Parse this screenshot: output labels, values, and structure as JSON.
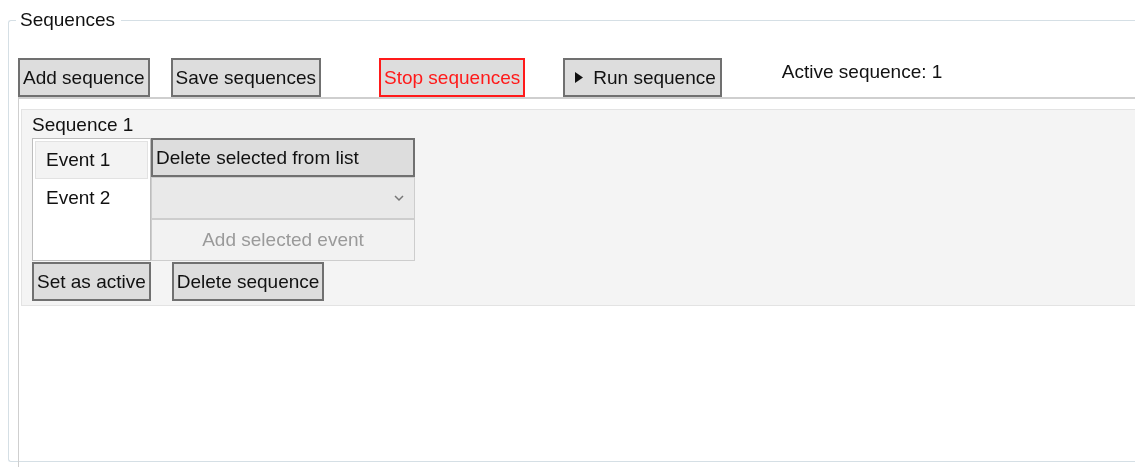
{
  "group": {
    "title": "Sequences"
  },
  "toolbar": [
    {
      "label": "Add sequence",
      "kind": "normal"
    },
    {
      "label": "Save sequences",
      "kind": "normal"
    },
    {
      "label": "Stop sequences",
      "kind": "stop"
    },
    {
      "label": "Run sequence",
      "kind": "run"
    }
  ],
  "active_label": "Active sequence: 1",
  "sequences": [
    {
      "title": "Sequence 1",
      "events": [
        {
          "label": "Event 1",
          "selected": true
        },
        {
          "label": "Event 2",
          "selected": false
        }
      ],
      "delete_selected": "Delete selected from list",
      "add_event": {
        "label": "Add selected event",
        "disabled": true
      },
      "set_active": "Set as active",
      "delete_sequence": "Delete sequence"
    }
  ]
}
